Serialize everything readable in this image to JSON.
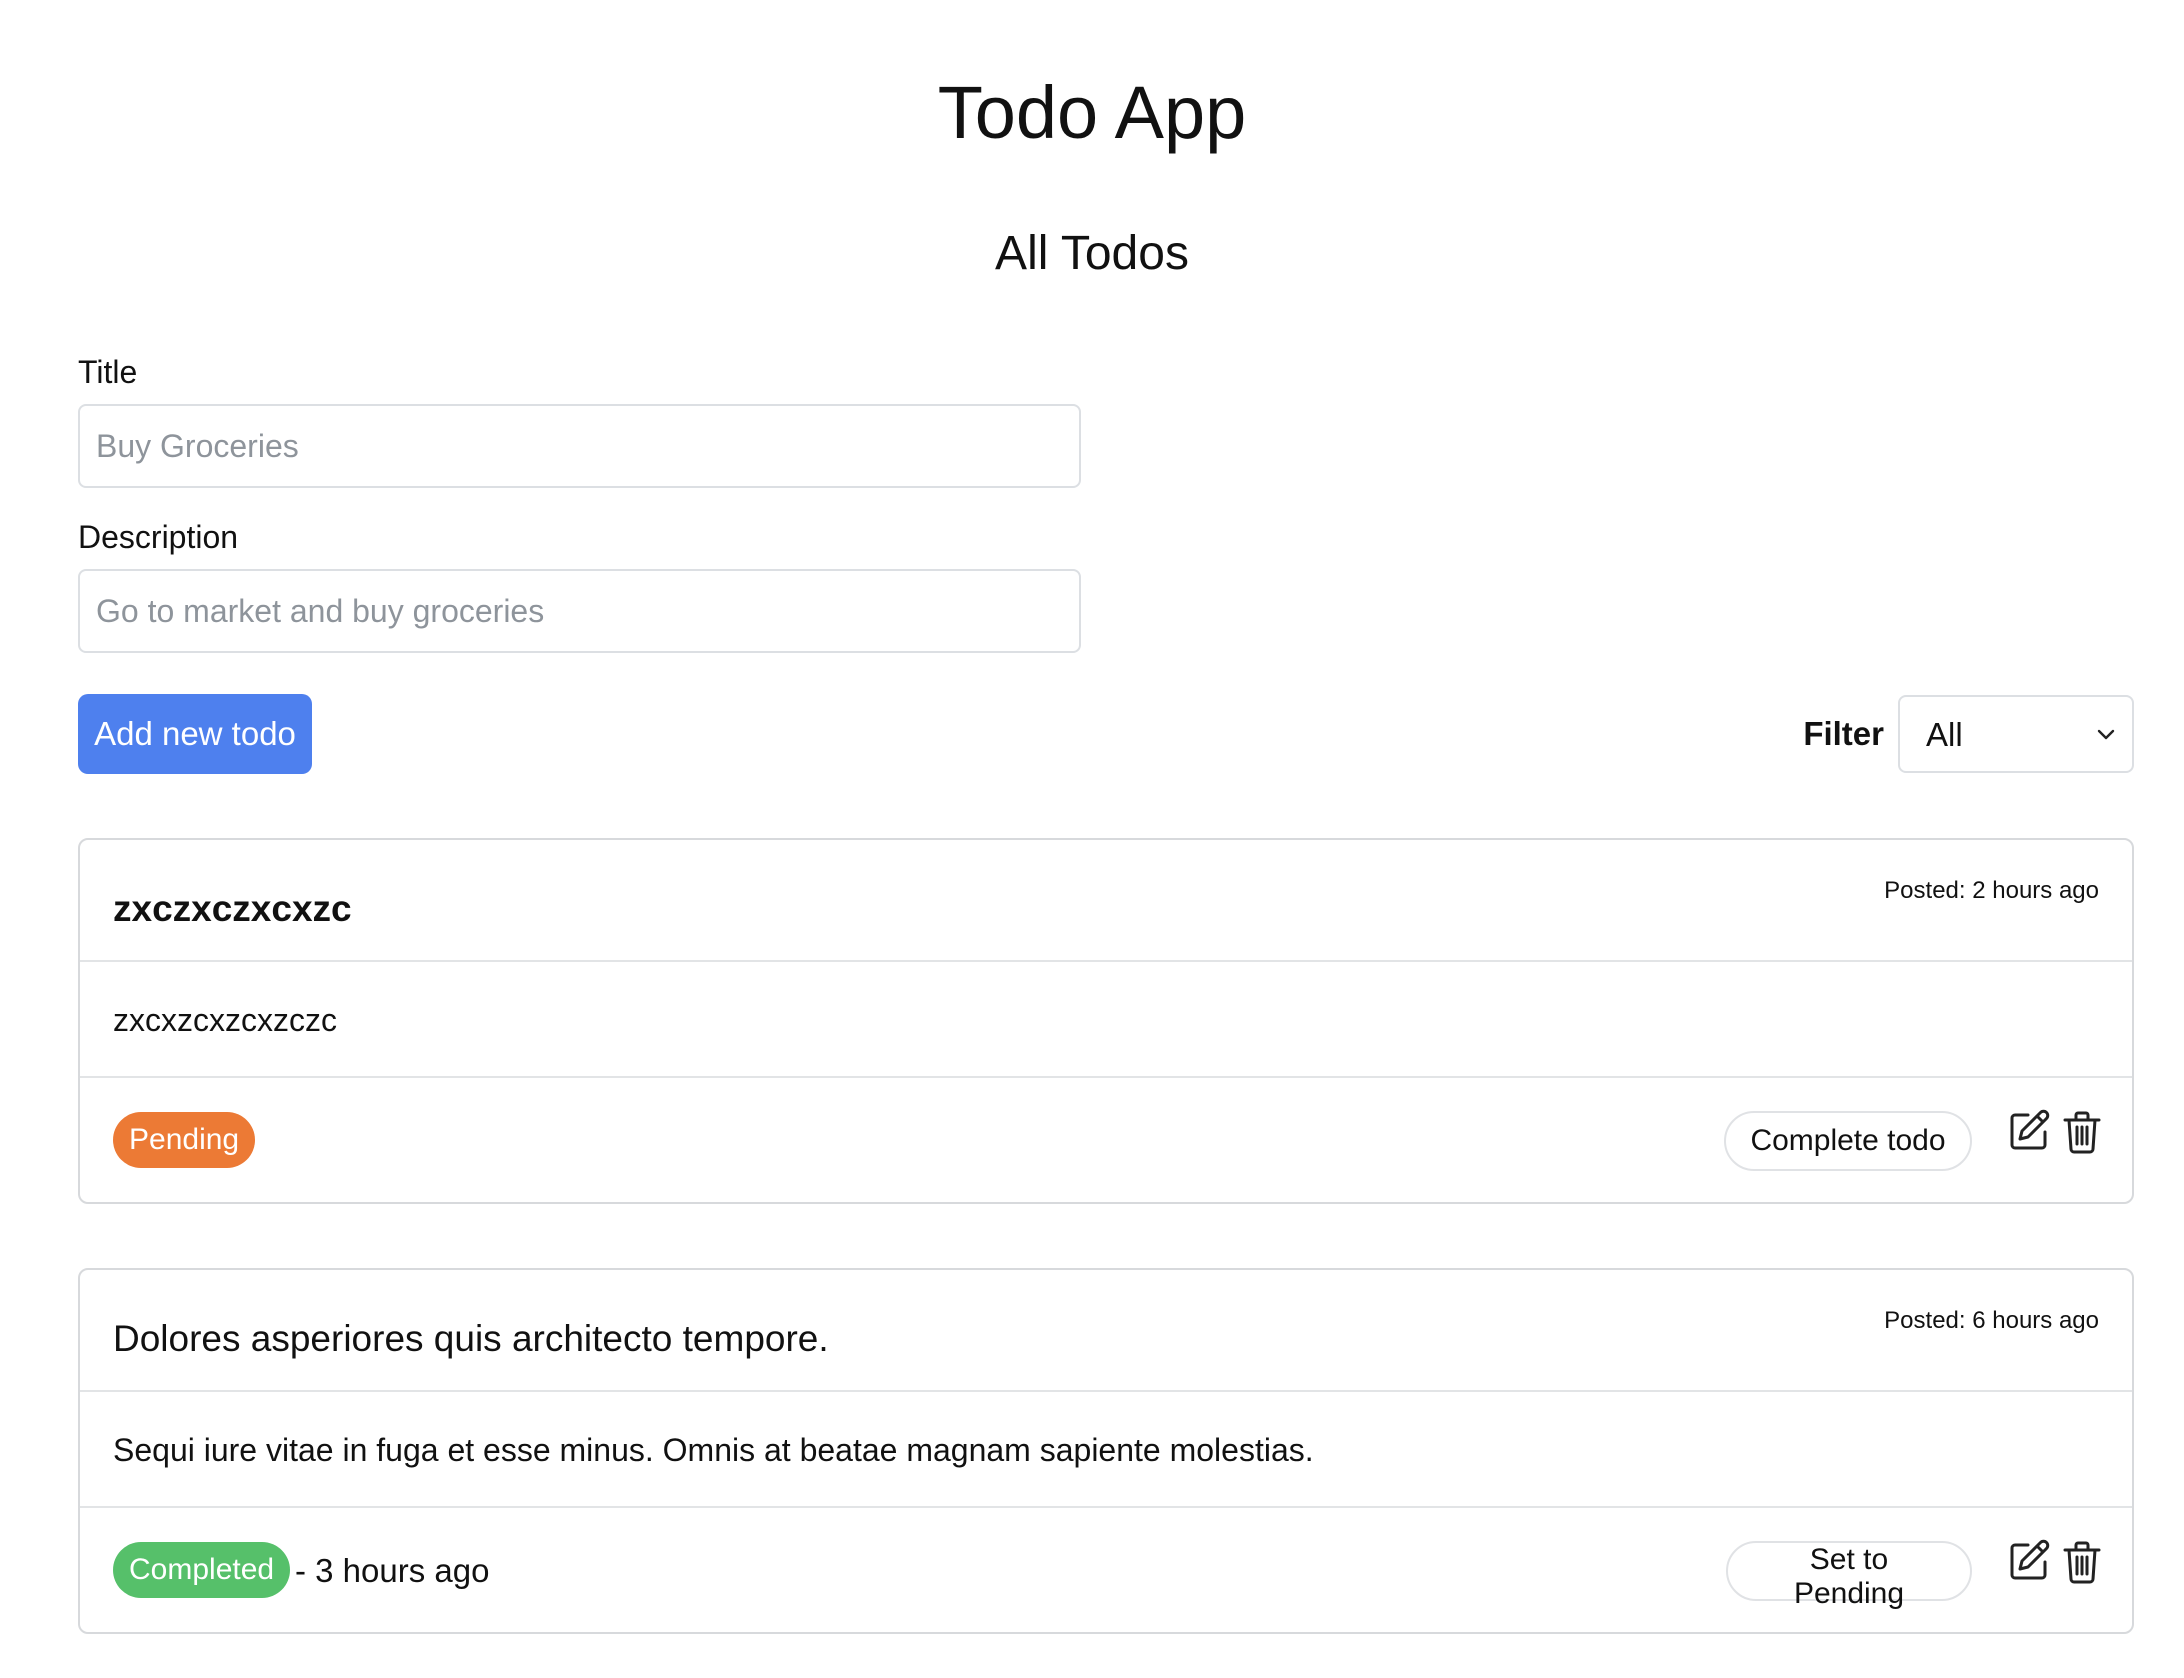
{
  "app": {
    "title": "Todo App",
    "section_title": "All Todos"
  },
  "form": {
    "title_label": "Title",
    "title_placeholder": "Buy Groceries",
    "title_value": "",
    "description_label": "Description",
    "description_placeholder": "Go to market and buy groceries",
    "description_value": "",
    "add_button_label": "Add new todo"
  },
  "filter": {
    "label": "Filter",
    "selected": "All"
  },
  "todos": [
    {
      "title": "zxczxczxcxzc",
      "posted": "Posted: 2 hours ago",
      "description": "zxcxzcxzcxzczc",
      "status": "Pending",
      "action_label": "Complete todo"
    },
    {
      "title": "Dolores asperiores quis architecto tempore.",
      "posted": "Posted: 6 hours ago",
      "description": "Sequi iure vitae in fuga et esse minus. Omnis at beatae magnam sapiente molestias.",
      "status": "Completed",
      "completed_time": "- 3 hours ago",
      "action_label": "Set to Pending"
    }
  ],
  "colors": {
    "primary": "#4e80ee",
    "pending": "#ec7a35",
    "completed": "#56c06a",
    "border": "#d7d9dc"
  },
  "icons": {
    "edit": "edit-icon",
    "delete": "trash-icon",
    "dropdown": "chevron-down-icon"
  }
}
